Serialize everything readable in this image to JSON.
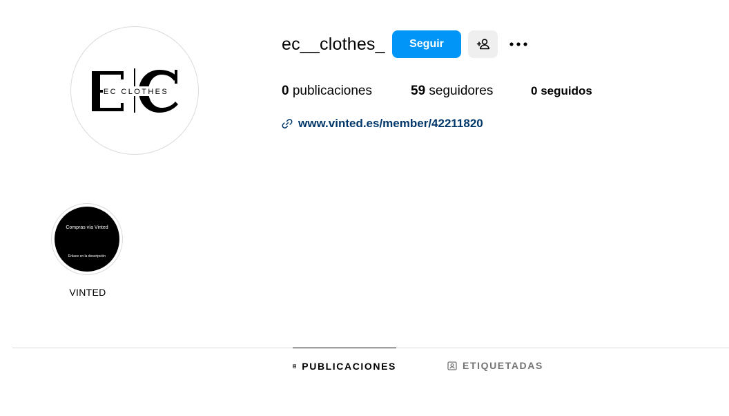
{
  "profile": {
    "username": "ec__clothes_",
    "avatar_logo_letters": "EC",
    "avatar_logo_text": "EC CLOTHES",
    "follow_label": "Seguir",
    "suggest_icon": "add-person-icon",
    "more_icon": "more-options-icon"
  },
  "stats": {
    "posts_count": "0",
    "posts_label": "publicaciones",
    "followers_count": "59",
    "followers_label": "seguidores",
    "following_count": "0",
    "following_label": "seguidos"
  },
  "link": {
    "icon": "link-icon",
    "text": "www.vinted.es/member/42211820"
  },
  "highlights": [
    {
      "title": "VINTED",
      "cover_line1": "Compras vía Vinted",
      "cover_line2": "Enlace en la descripción"
    }
  ],
  "tabs": [
    {
      "label": "PUBLICACIONES",
      "icon": "grid-icon",
      "active": true
    },
    {
      "label": "ETIQUETADAS",
      "icon": "tagged-icon",
      "active": false
    }
  ],
  "colors": {
    "accent": "#0095f6",
    "link": "#00376b",
    "muted": "#737373",
    "border": "#dbdbdb",
    "secondary_button": "#efefef"
  }
}
